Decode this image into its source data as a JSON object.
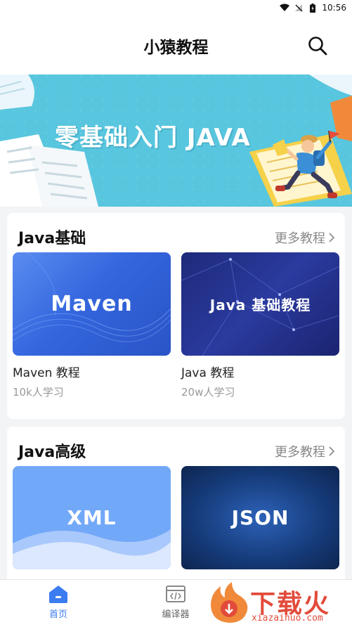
{
  "status_bar": {
    "time": "10:56"
  },
  "app_bar": {
    "title": "小猿教程"
  },
  "banner": {
    "headline": "零基础入门 JAVA"
  },
  "sections": [
    {
      "title": "Java基础",
      "more_label": "更多教程",
      "courses": [
        {
          "thumb_text": "Maven",
          "name": "Maven 教程",
          "learners": "10k人学习"
        },
        {
          "thumb_text": "Java 基础教程",
          "name": "Java 教程",
          "learners": "20w人学习"
        }
      ]
    },
    {
      "title": "Java高级",
      "more_label": "更多教程",
      "courses": [
        {
          "thumb_text": "XML",
          "name": "",
          "learners": ""
        },
        {
          "thumb_text": "JSON",
          "name": "",
          "learners": ""
        }
      ]
    }
  ],
  "tab_bar": {
    "items": [
      {
        "label": "首页",
        "icon": "home-icon",
        "active": true
      },
      {
        "label": "编译器",
        "icon": "code-icon",
        "active": false
      }
    ],
    "active_color": "#3b7cf0",
    "inactive_color": "#666666"
  },
  "watermark": {
    "text": "下载火",
    "url": "xiazaihuo.com"
  }
}
